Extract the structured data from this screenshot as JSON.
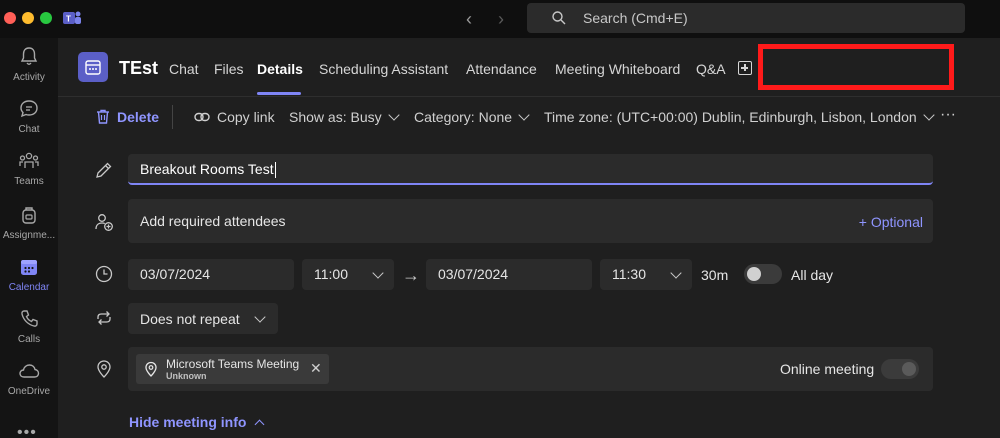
{
  "search": {
    "placeholder": "Search (Cmd+E)"
  },
  "rail": {
    "items": [
      {
        "label": "Activity"
      },
      {
        "label": "Chat"
      },
      {
        "label": "Teams"
      },
      {
        "label": "Assignme..."
      },
      {
        "label": "Calendar"
      },
      {
        "label": "Calls"
      },
      {
        "label": "OneDrive"
      }
    ],
    "more": "•••"
  },
  "header": {
    "title": "TEst",
    "tabs": [
      {
        "label": "Chat"
      },
      {
        "label": "Files"
      },
      {
        "label": "Details"
      },
      {
        "label": "Scheduling Assistant"
      },
      {
        "label": "Attendance"
      },
      {
        "label": "Meeting Whiteboard"
      },
      {
        "label": "Q&A"
      }
    ]
  },
  "toolbar": {
    "delete": "Delete",
    "copy_link": "Copy link",
    "show_as": "Show as: Busy",
    "category": "Category: None",
    "timezone_label": "Time zone:",
    "timezone_value": "(UTC+00:00) Dublin, Edinburgh, Lisbon, London",
    "more": "···"
  },
  "form": {
    "title_value": "Breakout Rooms Test",
    "attendees_placeholder": "Add required attendees",
    "optional_link": "+ Optional",
    "start_date": "03/07/2024",
    "start_time": "11:00",
    "end_date": "03/07/2024",
    "end_time": "11:30",
    "duration": "30m",
    "all_day_label": "All day",
    "repeat": "Does not repeat",
    "location_chip_title": "Microsoft Teams Meeting",
    "location_chip_sub": "Unknown",
    "online_meeting_label": "Online meeting",
    "hide_meeting_info": "Hide meeting info"
  },
  "colors": {
    "accent": "#7f85f5",
    "badge": "#5b5fc7",
    "redaction": "#ff1a1a"
  }
}
